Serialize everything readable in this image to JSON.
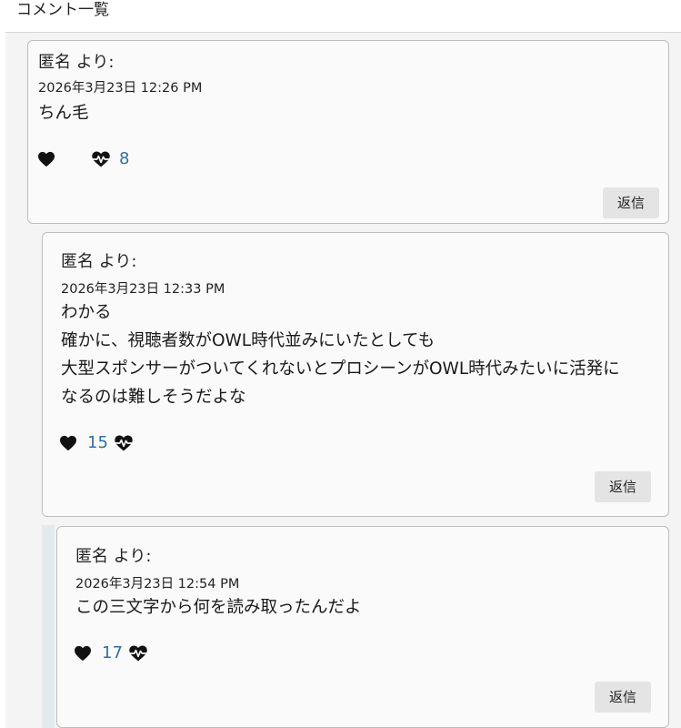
{
  "section": {
    "title": "コメント一覧"
  },
  "comments": [
    {
      "author": "匿名 より:",
      "timestamp": "2026年3月23日 12:26 PM",
      "body": [
        "ちん毛"
      ],
      "likes": "8",
      "reply_label": "返信"
    },
    {
      "author": "匿名 より:",
      "timestamp": "2026年3月23日 12:33 PM",
      "body": [
        "わかる",
        "確かに、視聴者数がOWL時代並みにいたとしても",
        "大型スポンサーがついてくれないとプロシーンがOWL時代みたいに活発に",
        "なるのは難しそうだよな"
      ],
      "likes": "15",
      "reply_label": "返信"
    },
    {
      "author": "匿名 より:",
      "timestamp": "2026年3月23日 12:54 PM",
      "body": [
        "この三文字から何を読み取ったんだよ"
      ],
      "likes": "17",
      "reply_label": "返信"
    }
  ],
  "icons": {
    "heart": "heart-icon",
    "heartbeat": "heartbeat-icon"
  },
  "colors": {
    "like_count": "#2f6fa8",
    "card_border": "#bdbdbd",
    "reply_button_bg": "#e4e4e4",
    "nest_bar": "#e2ecee"
  }
}
